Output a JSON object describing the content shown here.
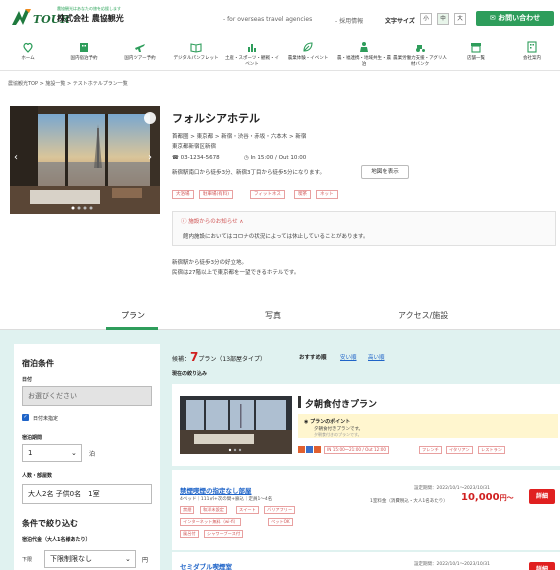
{
  "header": {
    "logo_text": "TOUR",
    "logo_tagline": "農協観光はあなたの旅を応援します",
    "company": "株式会社 農協観光",
    "link_overseas": "- for overseas travel agencies",
    "link_recruit": "- 採用情報",
    "font_size_label": "文字サイズ",
    "font_sizes": [
      "小",
      "中",
      "大"
    ],
    "contact": "お問い合わせ"
  },
  "nav": [
    {
      "icon": "home-icon",
      "label": "ホーム"
    },
    {
      "icon": "building-icon",
      "label": "国内宿泊予約"
    },
    {
      "icon": "airplane-icon",
      "label": "国内ツアー予約"
    },
    {
      "icon": "book-icon",
      "label": "デジタルパンフレット"
    },
    {
      "icon": "chart-icon",
      "label": "土産・スポーツ・観戦・イベント"
    },
    {
      "icon": "leaf-icon",
      "label": "農業体験・イベント"
    },
    {
      "icon": "person-icon",
      "label": "農・福連携・地域共生・農泊"
    },
    {
      "icon": "tractor-icon",
      "label": "農業労働力支援・アグリ人材バンク"
    },
    {
      "icon": "shop-icon",
      "label": "店舗一覧"
    },
    {
      "icon": "office-icon",
      "label": "会社案内"
    }
  ],
  "breadcrumb": "農協観光TOP > 施設一覧 > テストホテルプラン一覧",
  "hotel": {
    "name": "フォルシアホテル",
    "area": "首都圏 > 東京都 > 新宿・渋谷・赤坂・六本木 > 新宿",
    "address": "東京都新宿区新宿",
    "phone": "03-1234-5678",
    "checkin": "In 15:00 / Out 10:00",
    "access": "新宿駅南口から徒歩3分、新宿3丁目から徒歩5分になります。",
    "map_button": "地図を表示",
    "tags": [
      "大浴場",
      "駐車場(有料)",
      "フィットネス",
      "喫茶",
      "ネット"
    ],
    "notice_title": "施設からのお知らせ",
    "notice_body": "館内施設においてはコロナの状況によっては休止していることがあります。",
    "desc1": "新宿駅から徒歩3分の好立地。",
    "desc2": "民宿は27階以上で東京都を一望できるホテルです。"
  },
  "tabs": [
    "プラン",
    "写真",
    "アクセス/施設"
  ],
  "sidebar": {
    "title": "宿泊条件",
    "date_label": "日付",
    "date_placeholder": "お選びください",
    "no_date_label": "日付未指定",
    "nights_label": "宿泊期間",
    "nights_value": "1",
    "nights_unit": "泊",
    "guests_label": "人数・部屋数",
    "guests_value": "大人2名 子供0名　1室",
    "filter_title": "条件で絞り込む",
    "price_label": "宿泊代金（大人1名様あたり）",
    "min_label": "下限",
    "min_value": "下限制限なし",
    "yen": "円"
  },
  "results": {
    "count_prefix": "候補：",
    "count": "7",
    "count_suffix": "プラン（13部屋タイプ）",
    "sort_recommended": "おすすめ順",
    "sort_cheap": "安い順",
    "sort_expensive": "高い順",
    "filter_label": "現在の絞り込み"
  },
  "plan": {
    "title": "夕朝食付きプラン",
    "point_title": "プランのポイント",
    "point_body": "夕朝食付きプランです。",
    "point_sub": "夕朝食付きのプランです。",
    "chip_time": "IN 15:00～21:00 / Out 12:00",
    "chips": [
      "フレンチ",
      "イタリアン",
      "レストラン"
    ]
  },
  "room1": {
    "name": "禁煙喫煙の指定なし部屋",
    "spec": "4ベッド｜111㎡+次の間+廊込｜定員1～4名",
    "period": "設定期間：2022/10/1～2023/10/31",
    "price_note": "1室料金（消費税込・大人1名あたり）",
    "price": "10,000",
    "price_unit": "円～",
    "detail": "詳細",
    "chips_row1": [
      "禁煙",
      "和洋未設定",
      "スイート",
      "バリアフリー"
    ],
    "chips_row2": [
      "インターネット無料（wi-fi）",
      "ペットOK"
    ],
    "chips_row3": [
      "風呂付",
      "シャワーブース付"
    ]
  },
  "room2": {
    "name": "セミダブル喫煙室",
    "period": "設定期間：2022/10/1～2023/10/31",
    "detail": "詳細"
  },
  "colors": {
    "brand": "#2e9d5b",
    "accent": "#e02020",
    "lower_bg": "#e0f2f0"
  }
}
